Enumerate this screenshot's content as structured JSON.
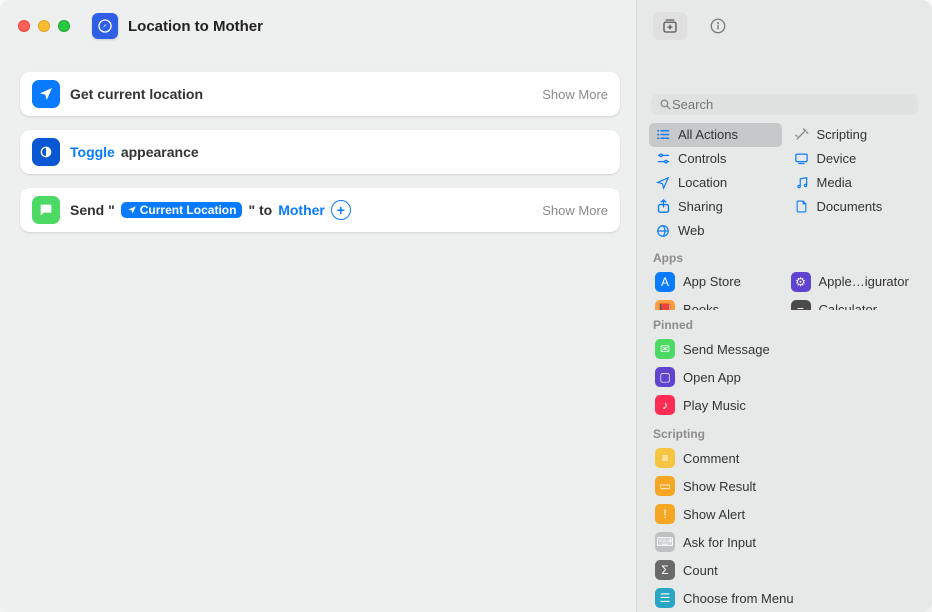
{
  "header": {
    "title": "Location to Mother",
    "icon": "compass-icon"
  },
  "actions": [
    {
      "id": "get-location",
      "icon": "location-arrow-icon",
      "iconColor": "#0a7bfe",
      "label": "Get current location",
      "showMore": "Show More"
    },
    {
      "id": "toggle-appearance",
      "icon": "appearance-icon",
      "iconColor": "#0a57d3",
      "linkText": "Toggle",
      "trailingText": "appearance"
    },
    {
      "id": "send-message",
      "icon": "messages-icon",
      "iconColor": "#4cd964",
      "prefix": "Send \"",
      "token": "Current Location",
      "mid": "\" to",
      "recipient": "Mother",
      "showMore": "Show More"
    }
  ],
  "search": {
    "placeholder": "Search"
  },
  "categories": [
    {
      "name": "All Actions",
      "icon": "list-icon",
      "color": "#0a7bfe",
      "selected": true
    },
    {
      "name": "Scripting",
      "icon": "wand-icon",
      "color": "#8a8a8a"
    },
    {
      "name": "Controls",
      "icon": "controls-icon",
      "color": "#0a7bfe"
    },
    {
      "name": "Device",
      "icon": "device-icon",
      "color": "#0a7bfe"
    },
    {
      "name": "Location",
      "icon": "location-icon",
      "color": "#0a7bfe"
    },
    {
      "name": "Media",
      "icon": "music-icon",
      "color": "#0a7bfe"
    },
    {
      "name": "Sharing",
      "icon": "share-icon",
      "color": "#0a7bfe"
    },
    {
      "name": "Documents",
      "icon": "document-icon",
      "color": "#0a7bfe"
    },
    {
      "name": "Web",
      "icon": "web-icon",
      "color": "#0a7bfe"
    }
  ],
  "appsHeader": "Apps",
  "apps": [
    {
      "name": "App Store",
      "color": "#0a7bfe"
    },
    {
      "name": "Apple…igurator",
      "color": "#5e44d1"
    },
    {
      "name": "Books",
      "color": "#ff9d3c"
    },
    {
      "name": "Calculator",
      "color": "#4a4a4a"
    }
  ],
  "pinnedHeader": "Pinned",
  "pinned": [
    {
      "name": "Send Message",
      "color": "#4cd964"
    },
    {
      "name": "Open App",
      "color": "#5e44d1"
    },
    {
      "name": "Play Music",
      "color": "#ff2d55"
    }
  ],
  "scriptingHeader": "Scripting",
  "scripting": [
    {
      "name": "Comment",
      "color": "#f5c542"
    },
    {
      "name": "Show Result",
      "color": "#f5a623"
    },
    {
      "name": "Show Alert",
      "color": "#f5a623"
    },
    {
      "name": "Ask for Input",
      "color": "#8a8a8a"
    },
    {
      "name": "Count",
      "color": "#6a6a6a"
    },
    {
      "name": "Choose from Menu",
      "color": "#2aa5c4"
    }
  ]
}
